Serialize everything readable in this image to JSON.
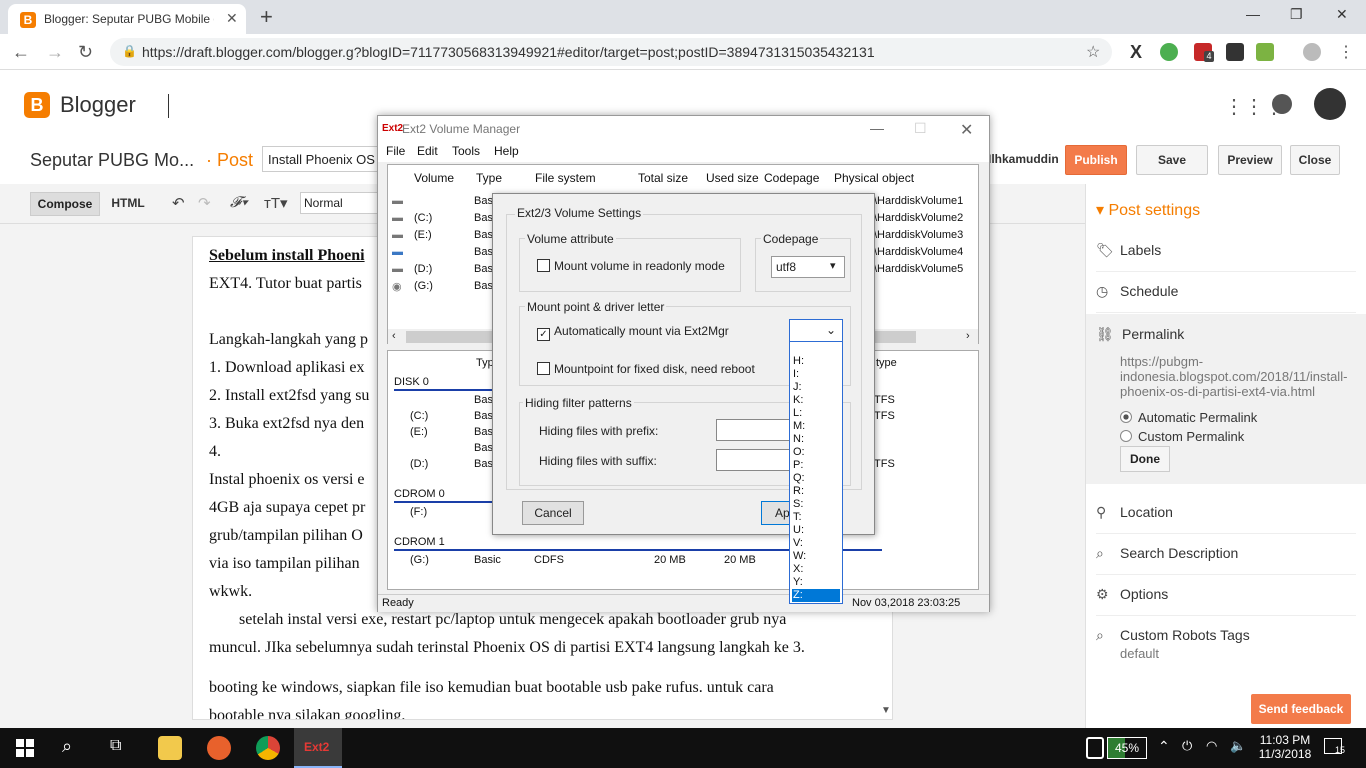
{
  "browser": {
    "tab_title": "Blogger: Seputar PUBG Mobile d...",
    "tab_favicon": "B",
    "url": "https://draft.blogger.com/blogger.g?blogID=7117730568313949921#editor/target=post;postID=3894731315035432131",
    "ext_badge": "4"
  },
  "blogger": {
    "logo_letter": "B",
    "app_name": "Blogger",
    "blog_title": "Seputar PUBG Mo...",
    "post_label": "· Post",
    "post_title_value": "Install Phoenix OS",
    "username": "Ilhkamuddin",
    "buttons": {
      "publish": "Publish",
      "save": "Save",
      "preview": "Preview",
      "close": "Close"
    },
    "editor": {
      "compose": "Compose",
      "html": "HTML",
      "format_select": "Normal"
    },
    "doc_lines": [
      "Sebelum install Phoeni",
      "EXT4.  Tutor buat partis",
      "Langkah-langkah yang p",
      "1. Download aplikasi ex",
      "2. Install ext2fsd yang su",
      "3. Buka ext2fsd nya den",
      "4.",
      "Instal phoenix os versi e",
      "4GB aja supaya cepet pr",
      "grub/tampilan pilihan O",
      "via iso tampilan pilihan",
      "wkwk.",
      "setelah instal versi exe, restart pc/laptop untuk mengecek apakah bootloader grub nya",
      "muncul. JIka sebelumnya sudah terinstal Phoenix OS di partisi EXT4 langsung langkah ke 3.",
      "booting ke windows, siapkan file iso kemudian buat bootable usb pake rufus. untuk cara",
      "bootable nya silakan googling."
    ],
    "sidebar": {
      "header": "Post settings",
      "items": [
        "Labels",
        "Schedule",
        "Permalink",
        "Location",
        "Search Description",
        "Options",
        "Custom Robots Tags"
      ],
      "permalink_url": "https://pubgm-indonesia.blogspot.com/2018/11/install-phoenix-os-di-partisi-ext4-via.html",
      "radio_auto": "Automatic Permalink",
      "radio_custom": "Custom Permalink",
      "done": "Done",
      "robots_default": "default"
    },
    "feedback": "Send feedback"
  },
  "ext2": {
    "title": "Ext2 Volume Manager",
    "icon_text": "Ext2",
    "menu": [
      "File",
      "Edit",
      "Tools",
      "Help"
    ],
    "columns": [
      "Volume",
      "Type",
      "File system",
      "Total size",
      "Used size",
      "Codepage",
      "Physical object"
    ],
    "volumes": [
      {
        "vol": "",
        "type": "Bas",
        "obj": "\\HarddiskVolume1"
      },
      {
        "vol": "(C:)",
        "type": "Bas",
        "obj": "\\HarddiskVolume2"
      },
      {
        "vol": "(E:)",
        "type": "Bas",
        "obj": "\\HarddiskVolume3"
      },
      {
        "vol": "",
        "type": "Bas",
        "obj": "\\HarddiskVolume4"
      },
      {
        "vol": "(D:)",
        "type": "Bas",
        "obj": "\\HarddiskVolume5"
      },
      {
        "vol": "(G:)",
        "type": "Bas",
        "obj": ""
      }
    ],
    "disk_header_type": "Typ",
    "disk_header_right": "type",
    "disk0": "DISK 0",
    "disk0_rows": [
      {
        "vol": "",
        "type": "Basi",
        "fs": ""
      },
      {
        "vol": "(C:)",
        "type": "Basi",
        "fs": "TFS"
      },
      {
        "vol": "(E:)",
        "type": "Basi",
        "fs": "TFS"
      },
      {
        "vol": "",
        "type": "Basi",
        "fs": ""
      },
      {
        "vol": "(D:)",
        "type": "Basi",
        "fs": "TFS"
      }
    ],
    "cdrom0": "CDROM 0",
    "cdrom0_row": "(F:)",
    "cdrom1": "CDROM 1",
    "cdrom1_row": {
      "vol": "(G:)",
      "type": "Basic",
      "fs": "CDFS",
      "total": "20 MB",
      "used": "20 MB"
    },
    "status_left": "Ready",
    "status_right": "Nov 03,2018 23:03:25"
  },
  "dialog": {
    "title": "Ext2/3 Volume Settings",
    "volume_attribute": "Volume attribute",
    "readonly": "Mount volume in readonly mode",
    "codepage_label": "Codepage",
    "codepage_value": "utf8",
    "mount_group": "Mount point & driver letter",
    "auto_mount": "Automatically mount via Ext2Mgr",
    "mountpoint_fixed": "Mountpoint for fixed disk, need reboot",
    "hiding_group": "Hiding filter patterns",
    "prefix": "Hiding files with prefix:",
    "suffix": "Hiding files with suffix:",
    "cancel": "Cancel",
    "apply": "Ap",
    "letters": [
      "H:",
      "I:",
      "J:",
      "K:",
      "L:",
      "M:",
      "N:",
      "O:",
      "P:",
      "Q:",
      "R:",
      "S:",
      "T:",
      "U:",
      "V:",
      "W:",
      "X:",
      "Y:",
      "Z:"
    ],
    "selected_letter": "Z:"
  },
  "taskbar": {
    "battery": "45%",
    "time": "11:03 PM",
    "date": "11/3/2018",
    "notif_count": "15",
    "ext2_label": "Ext2"
  },
  "colors": {
    "blogger_orange": "#f57d00",
    "publish": "#f37b4a",
    "selection": "#0078d7"
  }
}
